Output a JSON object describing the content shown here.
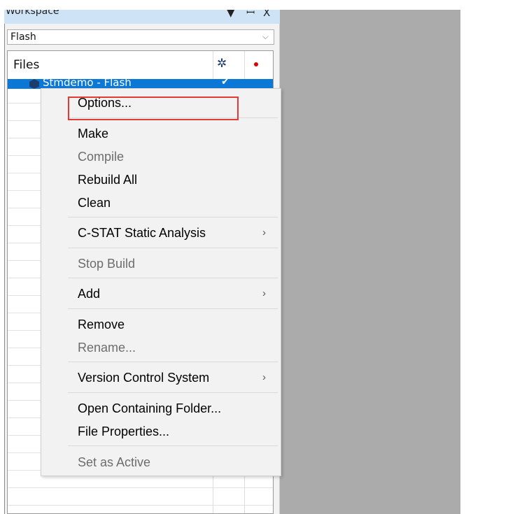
{
  "workspace": {
    "title": "Workspace",
    "controls": {
      "dropdown_arrow": "▼",
      "pin": "ᵖ",
      "close": "X"
    },
    "configuration": "Flash",
    "tree": {
      "column_header": "Files",
      "gear_icon": "gear-icon",
      "dot_color": "#e00000",
      "project_label": "Stmdemo - Flash",
      "project_check": "✔"
    }
  },
  "context_menu": {
    "options": "Options...",
    "make": "Make",
    "compile": "Compile",
    "rebuild_all": "Rebuild All",
    "clean": "Clean",
    "cstat": "C-STAT Static Analysis",
    "stop_build": "Stop Build",
    "add": "Add",
    "remove": "Remove",
    "rename": "Rename...",
    "vcs": "Version Control System",
    "open_folder": "Open Containing Folder...",
    "file_properties": "File Properties...",
    "set_active": "Set as Active",
    "submenu_arrow": "›"
  },
  "colors": {
    "selection": "#0b78d7",
    "highlight_box": "#e53935",
    "disabled_text": "#6d6d6d"
  }
}
